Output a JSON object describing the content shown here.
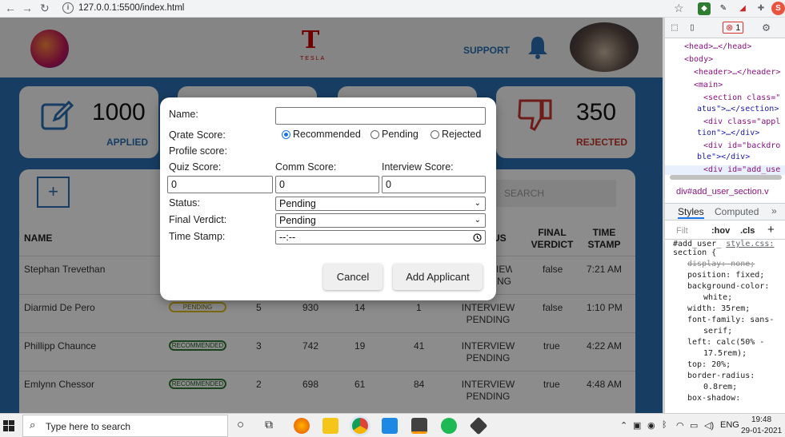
{
  "browser": {
    "url": "127.0.0.1:5500/index.html",
    "devtools_error_count": "1",
    "profile_initial": "S"
  },
  "header": {
    "brand_word": "TESLA",
    "support_label": "SUPPORT"
  },
  "stats": {
    "applied": {
      "value": "1000",
      "label": "APPLIED"
    },
    "rejected": {
      "value": "350",
      "label": "REJECTED"
    }
  },
  "toolbar": {
    "add_label": "+",
    "search_placeholder": "SEARCH"
  },
  "table": {
    "headers": {
      "name": "NAME",
      "status_fragment": "US",
      "final_verdict": "FINAL VERDICT",
      "time_stamp": "TIME STAMP"
    },
    "rows": [
      {
        "name": "Stephan Trevethan",
        "badge": "",
        "qrate": "",
        "profile": "",
        "quiz": "",
        "comm": "",
        "status": "IEW NG",
        "verdict": "false",
        "time": "7:21 AM"
      },
      {
        "name": "Diarmid De Pero",
        "badge": "PENDING",
        "qrate": "5",
        "profile": "930",
        "quiz": "14",
        "comm": "1",
        "status": "INTERVIEW PENDING",
        "verdict": "false",
        "time": "1:10 PM"
      },
      {
        "name": "Phillipp Chaunce",
        "badge": "RECOMMENDED",
        "qrate": "3",
        "profile": "742",
        "quiz": "19",
        "comm": "41",
        "status": "INTERVIEW PENDING",
        "verdict": "true",
        "time": "4:22 AM"
      },
      {
        "name": "Emlynn Chessor",
        "badge": "RECOMMENDED",
        "qrate": "2",
        "profile": "698",
        "quiz": "61",
        "comm": "84",
        "status": "INTERVIEW PENDING",
        "verdict": "true",
        "time": "4:48 AM"
      }
    ]
  },
  "modal": {
    "name_label": "Name:",
    "name_value": "",
    "qrate_label": "Qrate Score:",
    "qrate_options": [
      "Recommended",
      "Pending",
      "Rejected"
    ],
    "qrate_selected": "Recommended",
    "profile_label": "Profile score:",
    "quiz_label": "Quiz Score:",
    "comm_label": "Comm Score:",
    "interview_label": "Interview Score:",
    "quiz_value": "0",
    "comm_value": "0",
    "interview_value": "0",
    "status_label": "Status:",
    "status_value": "Pending",
    "verdict_label": "Final Verdict:",
    "verdict_value": "Pending",
    "timestamp_label": "Time Stamp:",
    "timestamp_value": "--:--",
    "cancel_label": "Cancel",
    "add_label": "Add Applicant"
  },
  "devtools": {
    "lines": {
      "head": "<head>…</head>",
      "body": "<body>",
      "header": "<header>…</header>",
      "main": "<main>",
      "section": "<section class=\"",
      "section2": "atus\">…</section>",
      "div_appl": "<div class=\"appl",
      "div_appl2": "tion\">…</div>",
      "backdrop": "<div id=\"backdro",
      "backdrop2": "ble\"></div>",
      "adduser": "<div id=\"add_use"
    },
    "breadcrumb": "div#add_user_section.v",
    "tabs": [
      "Styles",
      "Computed"
    ],
    "filter_placeholder": "Filt",
    "hov": ":hov",
    "cls": ".cls",
    "css": {
      "selector_tail": "#add_user_",
      "file": "style.css:",
      "selector": "section {",
      "display": "display: none;",
      "position": "position: fixed;",
      "bg": "background-color:",
      "bg_val": "white;",
      "width": "width: 35rem;",
      "font1": "font-family: sans-",
      "font2": "serif;",
      "left1": "left: calc(50% -",
      "left2": "17.5rem);",
      "top": "top: 20%;",
      "radius1": "border-radius:",
      "radius2": "0.8rem;",
      "shadow": "box-shadow:"
    }
  },
  "taskbar": {
    "search_placeholder": "Type here to search",
    "lang": "ENG",
    "time": "19:48",
    "date": "29-01-2021"
  },
  "colors": {
    "accent": "#2a6fb3",
    "rejected": "#c8342b",
    "modal_bg": "#ffffff"
  }
}
